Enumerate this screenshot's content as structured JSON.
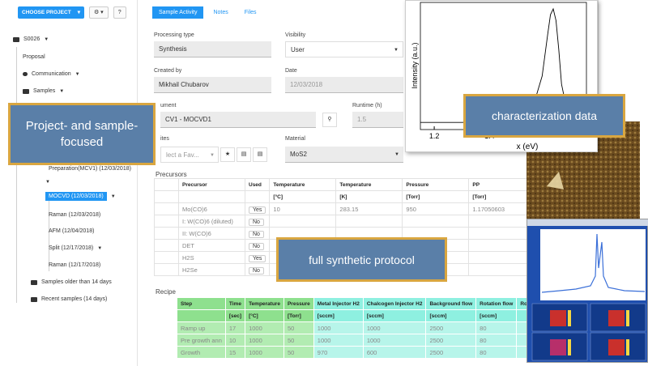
{
  "sidebar": {
    "choose_project": "CHOOSE PROJECT",
    "gear": "⚙ ▾",
    "help": "?",
    "items": [
      {
        "label": "S0026"
      },
      {
        "label": "Proposal"
      },
      {
        "label": "Communication"
      },
      {
        "label": "Samples"
      },
      {
        "label": "Preparation(MCV1) (12/03/2018)"
      },
      {
        "label": "MOCVD (12/03/2018)"
      },
      {
        "label": "Raman (12/03/2018)"
      },
      {
        "label": "AFM (12/04/2018)"
      },
      {
        "label": "Split (12/17/2018)"
      },
      {
        "label": "Raman (12/17/2018)"
      },
      {
        "label": "Samples older than 14 days"
      },
      {
        "label": "Recent samples (14 days)"
      }
    ]
  },
  "tabs": [
    "Sample Activity",
    "Notes",
    "Files"
  ],
  "form": {
    "processing_type_label": "Processing type",
    "processing_type_value": "Synthesis",
    "visibility_label": "Visibility",
    "visibility_value": "User",
    "created_by_label": "Created by",
    "created_by_value": "Mikhail Chubarov",
    "date_label": "Date",
    "date_value": "12/03/2018",
    "instrument_label": "ument",
    "instrument_value": "CV1 - MOCVD1",
    "runtime_label": "Runtime (h)",
    "runtime_value": "1.5",
    "favorites_label": "ites",
    "favorites_placeholder": "lect a Fav...",
    "material_label": "Material",
    "material_value": "MoS2"
  },
  "precursors": {
    "title": "Precursors",
    "headers": [
      "Precursor",
      "Used",
      "Temperature",
      "Temperature",
      "Pressure",
      "PP"
    ],
    "units": [
      "",
      "",
      "[°C]",
      "[K]",
      "[Torr]",
      "[Torr]"
    ],
    "rows": [
      [
        "Mo(CO)6",
        "Yes",
        "10",
        "283.15",
        "950",
        "1.17050603"
      ],
      [
        "I: W(CO)6 (diluted)",
        "No",
        "",
        "",
        "",
        ""
      ],
      [
        "II: W(CO)6",
        "No",
        "",
        "",
        "",
        ""
      ],
      [
        "DET",
        "No",
        "",
        "",
        "",
        ""
      ],
      [
        "H2S",
        "Yes",
        "",
        "",
        "",
        ""
      ],
      [
        "H2Se",
        "No",
        "",
        "",
        "",
        ""
      ]
    ]
  },
  "recipe": {
    "title": "Recipe",
    "headers": [
      "Step",
      "Time",
      "Temperature",
      "Pressure",
      "Metal Injector H2",
      "Chalcogen Injector H2",
      "Background flow",
      "Rotation flow",
      "Rotati"
    ],
    "units": [
      "",
      "[sec]",
      "[°C]",
      "[Torr]",
      "[sccm]",
      "[sccm]",
      "[sccm]",
      "[sccm]",
      ""
    ],
    "rows": [
      [
        "Ramp up",
        "17",
        "1000",
        "50",
        "1000",
        "1000",
        "2500",
        "80",
        ""
      ],
      [
        "Pre growth ann",
        "10",
        "1000",
        "50",
        "1000",
        "1000",
        "2500",
        "80",
        ""
      ],
      [
        "Growth",
        "15",
        "1000",
        "50",
        "970",
        "600",
        "2500",
        "80",
        ""
      ]
    ]
  },
  "callouts": {
    "project": "Project- and sample-focused",
    "characterization": "characterization data",
    "protocol": "full synthetic protocol"
  },
  "chart_data": {
    "type": "line",
    "xlabel": "x (eV)",
    "ylabel": "Intensity (a.u.)",
    "xlim": [
      1.15,
      1.75
    ],
    "x_ticks": [
      "1.2",
      "1.4"
    ],
    "series": [
      {
        "x": [
          1.15,
          1.3,
          1.45,
          1.52,
          1.56,
          1.59,
          1.61,
          1.62,
          1.63,
          1.64,
          1.65,
          1.66,
          1.68,
          1.72,
          1.75
        ],
        "values": [
          0.02,
          0.02,
          0.03,
          0.06,
          0.18,
          0.42,
          0.78,
          0.95,
          1.0,
          0.9,
          0.65,
          0.35,
          0.12,
          0.04,
          0.02
        ]
      }
    ]
  },
  "colors": {
    "primary": "#2196f3",
    "callout_fill": "#5a7fa8",
    "callout_border": "#d9a640"
  }
}
